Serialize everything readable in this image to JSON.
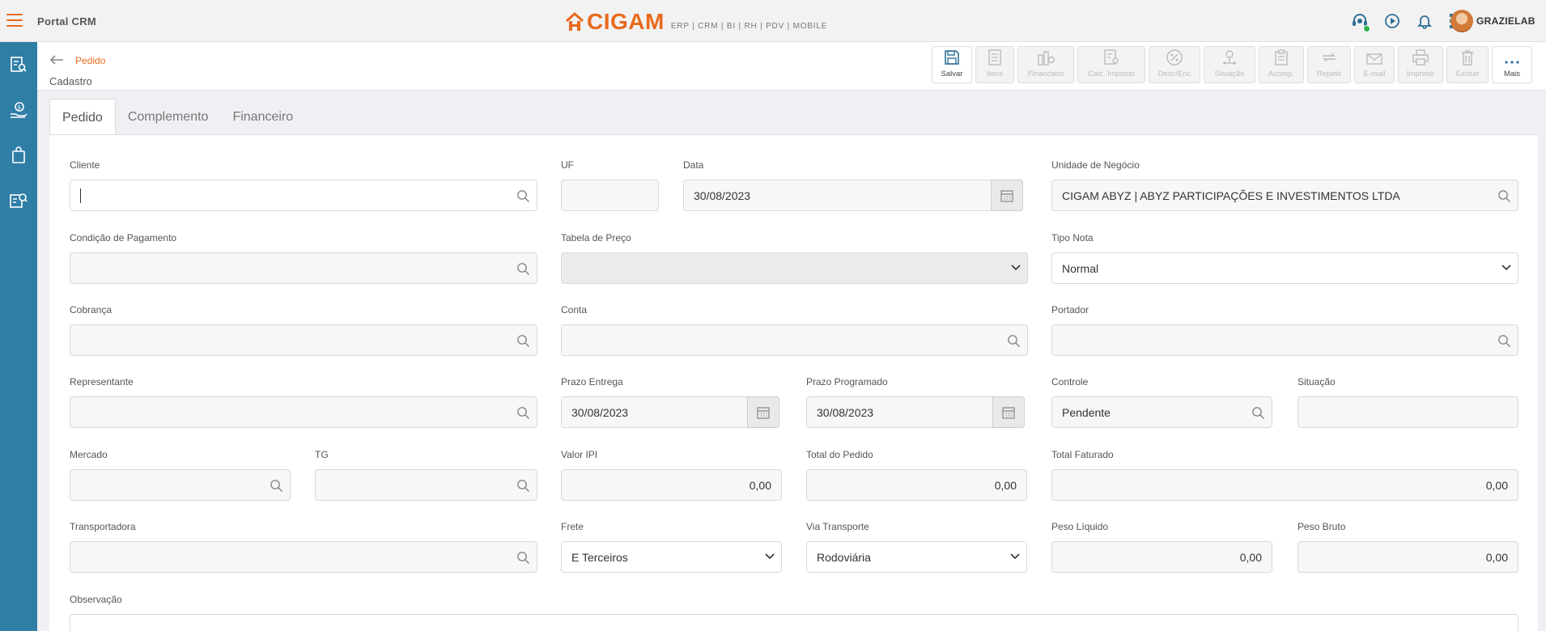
{
  "header": {
    "app_title": "Portal CRM",
    "logo_text": "CIGAM",
    "logo_sub": "ERP | CRM | BI | RH | PDV | MOBILE",
    "user_name": "GRAZIELAB"
  },
  "colors": {
    "accent": "#e86a1d",
    "sidebar": "#2f7ea6",
    "online": "#2fb344"
  },
  "page": {
    "breadcrumb": "Pedido",
    "subtitle": "Cadastro"
  },
  "toolbar": [
    {
      "label": "Salvar",
      "icon": "save-icon",
      "enabled": true
    },
    {
      "label": "Itens",
      "icon": "list-icon",
      "enabled": false
    },
    {
      "label": "Financeiro",
      "icon": "money-icon",
      "enabled": false
    },
    {
      "label": "Calc. Imposto",
      "icon": "calc-tax-icon",
      "enabled": false
    },
    {
      "label": "Desc/Enc",
      "icon": "percent-icon",
      "enabled": false
    },
    {
      "label": "Situação",
      "icon": "status-icon",
      "enabled": false
    },
    {
      "label": "Acomp.",
      "icon": "clipboard-icon",
      "enabled": false
    },
    {
      "label": "Repetir",
      "icon": "repeat-icon",
      "enabled": false
    },
    {
      "label": "E-mail",
      "icon": "mail-icon",
      "enabled": false
    },
    {
      "label": "Imprimir",
      "icon": "print-icon",
      "enabled": false
    },
    {
      "label": "Excluir",
      "icon": "trash-icon",
      "enabled": false
    },
    {
      "label": "Mais",
      "icon": "more-icon",
      "enabled": true
    }
  ],
  "tabs": [
    {
      "label": "Pedido",
      "active": true
    },
    {
      "label": "Complemento",
      "active": false
    },
    {
      "label": "Financeiro",
      "active": false
    }
  ],
  "form": {
    "cliente": {
      "label": "Cliente",
      "value": ""
    },
    "uf": {
      "label": "UF",
      "value": ""
    },
    "data": {
      "label": "Data",
      "value": "30/08/2023"
    },
    "unidade": {
      "label": "Unidade de Negócio",
      "value": "CIGAM ABYZ | ABYZ PARTICIPAÇÕES E INVESTIMENTOS LTDA"
    },
    "condicao": {
      "label": "Condição de Pagamento",
      "value": ""
    },
    "tabela": {
      "label": "Tabela de Preço",
      "value": ""
    },
    "tipo_nota": {
      "label": "Tipo Nota",
      "value": "Normal"
    },
    "cobranca": {
      "label": "Cobrança",
      "value": ""
    },
    "conta": {
      "label": "Conta",
      "value": ""
    },
    "portador": {
      "label": "Portador",
      "value": ""
    },
    "representante": {
      "label": "Representante",
      "value": ""
    },
    "prazo_entrega": {
      "label": "Prazo Entrega",
      "value": "30/08/2023"
    },
    "prazo_programado": {
      "label": "Prazo Programado",
      "value": "30/08/2023"
    },
    "controle": {
      "label": "Controle",
      "value": "Pendente"
    },
    "situacao": {
      "label": "Situação",
      "value": ""
    },
    "mercado": {
      "label": "Mercado",
      "value": ""
    },
    "tg": {
      "label": "TG",
      "value": ""
    },
    "valor_ipi": {
      "label": "Valor IPI",
      "value": "0,00"
    },
    "total_pedido": {
      "label": "Total do Pedido",
      "value": "0,00"
    },
    "total_faturado": {
      "label": "Total Faturado",
      "value": "0,00"
    },
    "transportadora": {
      "label": "Transportadora",
      "value": ""
    },
    "frete": {
      "label": "Frete",
      "value": "E Terceiros"
    },
    "via_transporte": {
      "label": "Via Transporte",
      "value": "Rodoviária"
    },
    "peso_liquido": {
      "label": "Peso Líquido",
      "value": "0,00"
    },
    "peso_bruto": {
      "label": "Peso Bruto",
      "value": "0,00"
    },
    "observacao": {
      "label": "Observação",
      "value": ""
    }
  }
}
